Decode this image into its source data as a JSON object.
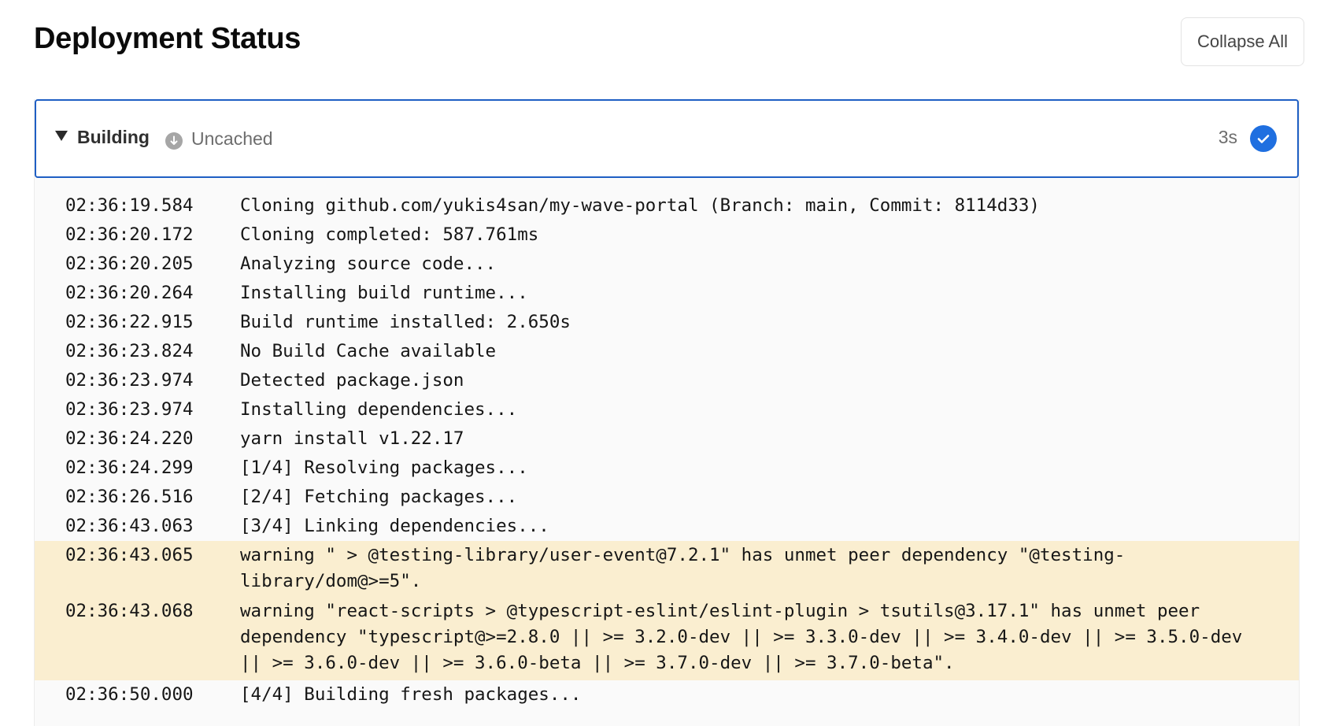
{
  "page": {
    "title": "Deployment Status",
    "collapse_all_label": "Collapse All"
  },
  "section": {
    "toggle_icon": "caret-down-icon",
    "title": "Building",
    "cache_icon": "download-circle-icon",
    "cache_status": "Uncached",
    "duration": "3s",
    "status_icon": "check-circle-icon",
    "accent_color": "#1f6fe0"
  },
  "logs": [
    {
      "time": "02:36:19.584",
      "message": "Cloning github.com/yukis4san/my-wave-portal (Branch: main, Commit: 8114d33)",
      "level": "info"
    },
    {
      "time": "02:36:20.172",
      "message": "Cloning completed: 587.761ms",
      "level": "info"
    },
    {
      "time": "02:36:20.205",
      "message": "Analyzing source code...",
      "level": "info"
    },
    {
      "time": "02:36:20.264",
      "message": "Installing build runtime...",
      "level": "info"
    },
    {
      "time": "02:36:22.915",
      "message": "Build runtime installed: 2.650s",
      "level": "info"
    },
    {
      "time": "02:36:23.824",
      "message": "No Build Cache available",
      "level": "info"
    },
    {
      "time": "02:36:23.974",
      "message": "Detected package.json",
      "level": "info"
    },
    {
      "time": "02:36:23.974",
      "message": "Installing dependencies...",
      "level": "info"
    },
    {
      "time": "02:36:24.220",
      "message": "yarn install v1.22.17",
      "level": "info"
    },
    {
      "time": "02:36:24.299",
      "message": "[1/4] Resolving packages...",
      "level": "info"
    },
    {
      "time": "02:36:26.516",
      "message": "[2/4] Fetching packages...",
      "level": "info"
    },
    {
      "time": "02:36:43.063",
      "message": "[3/4] Linking dependencies...",
      "level": "info"
    },
    {
      "time": "02:36:43.065",
      "message": "warning \" > @testing-library/user-event@7.2.1\" has unmet peer dependency \"@testing-library/dom@>=5\".",
      "level": "warning"
    },
    {
      "time": "02:36:43.068",
      "message": "warning \"react-scripts > @typescript-eslint/eslint-plugin > tsutils@3.17.1\" has unmet peer dependency \"typescript@>=2.8.0 || >= 3.2.0-dev || >= 3.3.0-dev || >= 3.4.0-dev || >= 3.5.0-dev || >= 3.6.0-dev || >= 3.6.0-beta || >= 3.7.0-dev || >= 3.7.0-beta\".",
      "level": "warning"
    },
    {
      "time": "02:36:50.000",
      "message": "[4/4] Building fresh packages...",
      "level": "info"
    }
  ]
}
